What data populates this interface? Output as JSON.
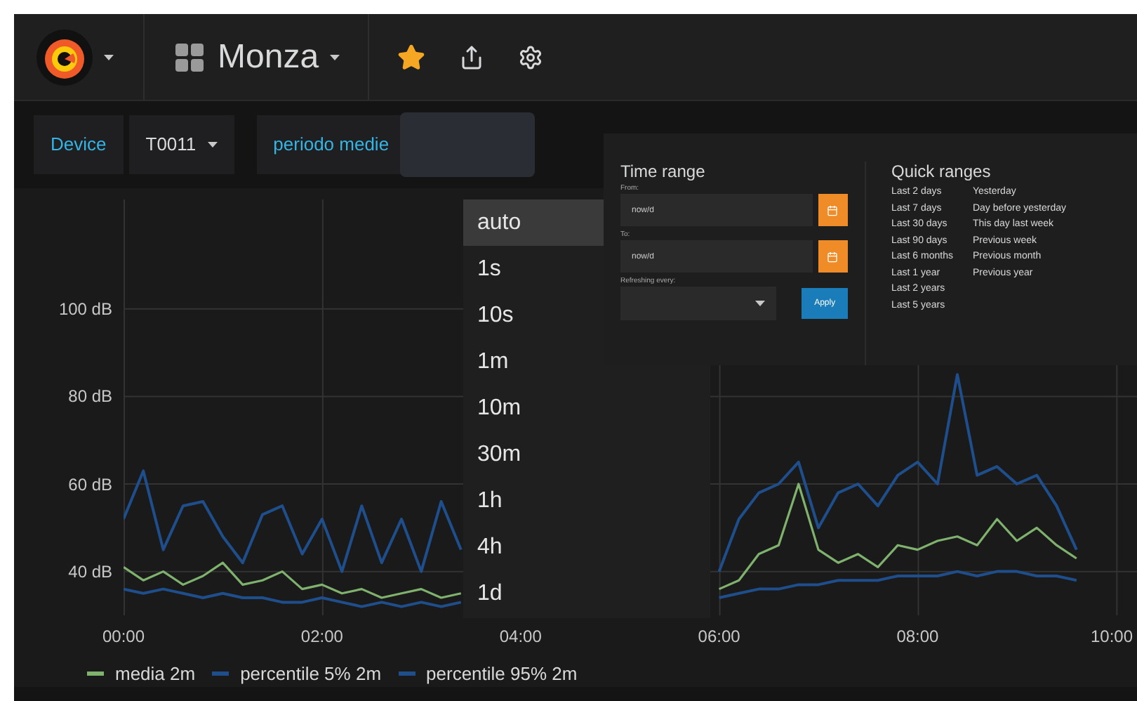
{
  "navbar": {
    "dashboard_title": "Monza",
    "starred": true
  },
  "variables": [
    {
      "label": "Device",
      "value": "T0011",
      "kind": "select"
    },
    {
      "label": "periodo medie",
      "kind": "input"
    }
  ],
  "interval_dropdown": {
    "options": [
      {
        "label": "auto",
        "selected": true
      },
      {
        "label": "1s",
        "selected": false
      },
      {
        "label": "10s",
        "selected": false
      },
      {
        "label": "1m",
        "selected": false
      },
      {
        "label": "10m",
        "selected": false
      },
      {
        "label": "30m",
        "selected": false
      },
      {
        "label": "1h",
        "selected": false
      },
      {
        "label": "4h",
        "selected": false
      },
      {
        "label": "1d",
        "selected": false
      }
    ]
  },
  "time_picker": {
    "title": "Time range",
    "from_label": "From:",
    "from_value": "now/d",
    "to_label": "To:",
    "to_value": "now/d",
    "refresh_label": "Refreshing every:",
    "apply": "Apply",
    "quick_title": "Quick ranges",
    "quick_columns": [
      [
        "Last 2 days",
        "Last 7 days",
        "Last 30 days",
        "Last 90 days",
        "Last 6 months",
        "Last 1 year",
        "Last 2 years",
        "Last 5 years"
      ],
      [
        "Yesterday",
        "Day before yesterday",
        "This day last week",
        "Previous week",
        "Previous month",
        "Previous year"
      ]
    ]
  },
  "graph": {
    "chart_data": {
      "type": "line",
      "x": [
        0,
        0.2,
        0.4,
        0.6,
        0.8,
        1,
        1.2,
        1.4,
        1.6,
        1.8,
        2,
        2.2,
        2.4,
        2.6,
        2.8,
        3,
        3.2,
        3.4,
        6,
        6.2,
        6.4,
        6.6,
        6.8,
        7,
        7.2,
        7.4,
        7.6,
        7.8,
        8,
        8.2,
        8.4,
        8.6,
        8.8,
        9,
        9.2,
        9.4,
        9.6
      ],
      "series": [
        {
          "name": "media 2m",
          "color": "#7eb26d",
          "values": [
            41,
            38,
            40,
            37,
            39,
            42,
            37,
            38,
            40,
            36,
            37,
            35,
            36,
            34,
            35,
            36,
            34,
            35,
            36,
            38,
            44,
            46,
            60,
            45,
            42,
            44,
            41,
            46,
            45,
            47,
            48,
            46,
            52,
            47,
            50,
            46,
            43
          ]
        },
        {
          "name": "percentile 5% 2m",
          "color": "#1f4e8c",
          "values": [
            36,
            35,
            36,
            35,
            34,
            35,
            34,
            34,
            33,
            33,
            34,
            33,
            32,
            33,
            32,
            33,
            32,
            33,
            34,
            35,
            36,
            36,
            37,
            37,
            38,
            38,
            38,
            39,
            39,
            39,
            40,
            39,
            40,
            40,
            39,
            39,
            38
          ]
        },
        {
          "name": "percentile 95% 2m",
          "color": "#1f4e8c",
          "values": [
            52,
            63,
            45,
            55,
            56,
            48,
            42,
            53,
            55,
            44,
            52,
            40,
            55,
            42,
            52,
            40,
            56,
            45,
            40,
            52,
            58,
            60,
            65,
            50,
            58,
            60,
            55,
            62,
            65,
            60,
            85,
            62,
            64,
            60,
            62,
            55,
            45
          ]
        }
      ],
      "xlim": [
        0,
        10.21
      ],
      "ylim": [
        30,
        125
      ],
      "grid": true,
      "legend": true,
      "xticks": [
        {
          "value": 0,
          "label": "00:00"
        },
        {
          "value": 2,
          "label": "02:00"
        },
        {
          "value": 4,
          "label": "04:00"
        },
        {
          "value": 6,
          "label": "06:00"
        },
        {
          "value": 8,
          "label": "08:00"
        },
        {
          "value": 10,
          "label": "10:00"
        }
      ],
      "yticks": [
        {
          "value": 100,
          "label": "100 dB"
        },
        {
          "value": 80,
          "label": "80 dB"
        },
        {
          "value": 60,
          "label": "60 dB"
        },
        {
          "value": 40,
          "label": "40 dB"
        }
      ]
    }
  }
}
